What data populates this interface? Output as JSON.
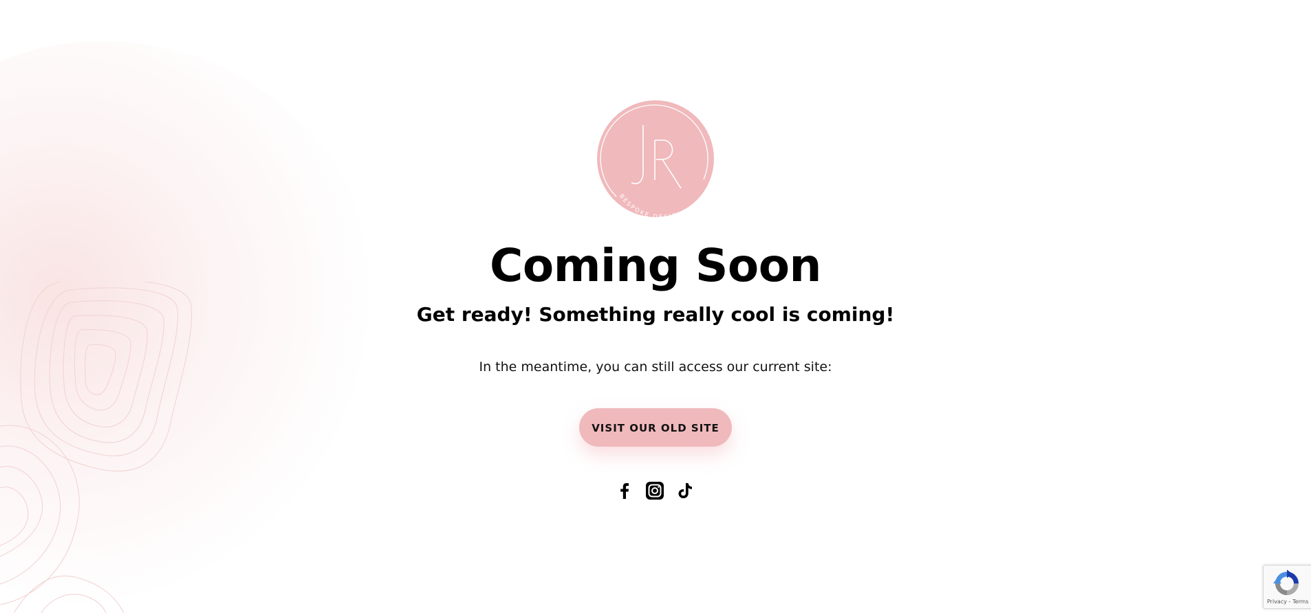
{
  "logo": {
    "monogram": "JR",
    "ring_text": "BESPOKE DESIGNS",
    "color": "#f0b9bc"
  },
  "hero": {
    "title": "Coming Soon",
    "subtitle": "Get ready! Something really cool is coming!",
    "meantime_text": "In the meantime, you can still access our current site:"
  },
  "cta": {
    "label": "VISIT OUR OLD SITE",
    "color": "#f0b9bc"
  },
  "socials": [
    {
      "name": "facebook-icon"
    },
    {
      "name": "instagram-icon"
    },
    {
      "name": "tiktok-icon"
    }
  ],
  "recaptcha": {
    "privacy_label": "Privacy",
    "separator": " - ",
    "terms_label": "Terms"
  }
}
